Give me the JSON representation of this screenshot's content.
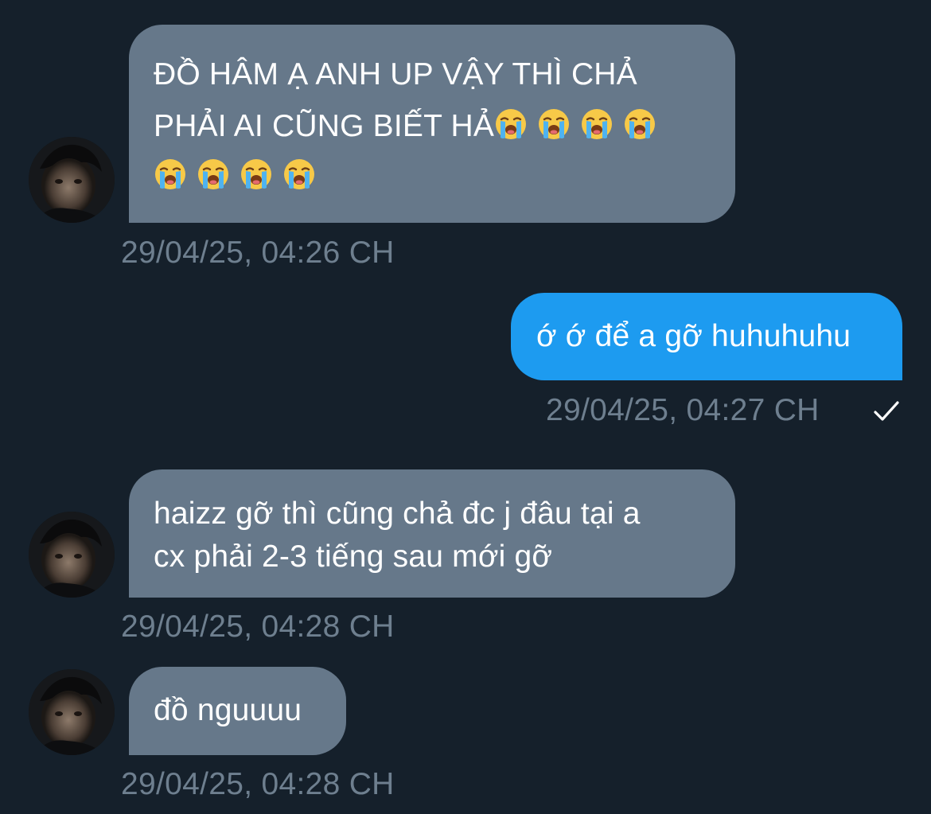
{
  "colors": {
    "background": "#15202b",
    "incoming_bubble": "#66788a",
    "outgoing_bubble": "#1d9bf0",
    "timestamp": "#6e7f8f",
    "text": "#ffffff"
  },
  "messages": [
    {
      "direction": "incoming",
      "lines": [
        "ĐỒ HÂM Ạ ANH UP VẬY THÌ CHẢ",
        "PHẢI AI CŨNG BIẾT HẢ"
      ],
      "emoji": "loudly-crying-face",
      "emoji_after_line2": 4,
      "emoji_line3": 4,
      "timestamp": "29/04/25, 04:26 CH"
    },
    {
      "direction": "outgoing",
      "lines": [
        "ớ ớ để a gỡ huhuhuhu"
      ],
      "timestamp": "29/04/25, 04:27 CH",
      "status_icon": "check-icon"
    },
    {
      "direction": "incoming",
      "lines": [
        "haizz gỡ thì cũng chả đc j đâu tại a",
        "cx phải 2-3 tiếng sau mới gỡ"
      ],
      "timestamp": "29/04/25, 04:28 CH"
    },
    {
      "direction": "incoming",
      "lines": [
        "đồ nguuuu"
      ],
      "timestamp": "29/04/25, 04:28 CH"
    }
  ]
}
